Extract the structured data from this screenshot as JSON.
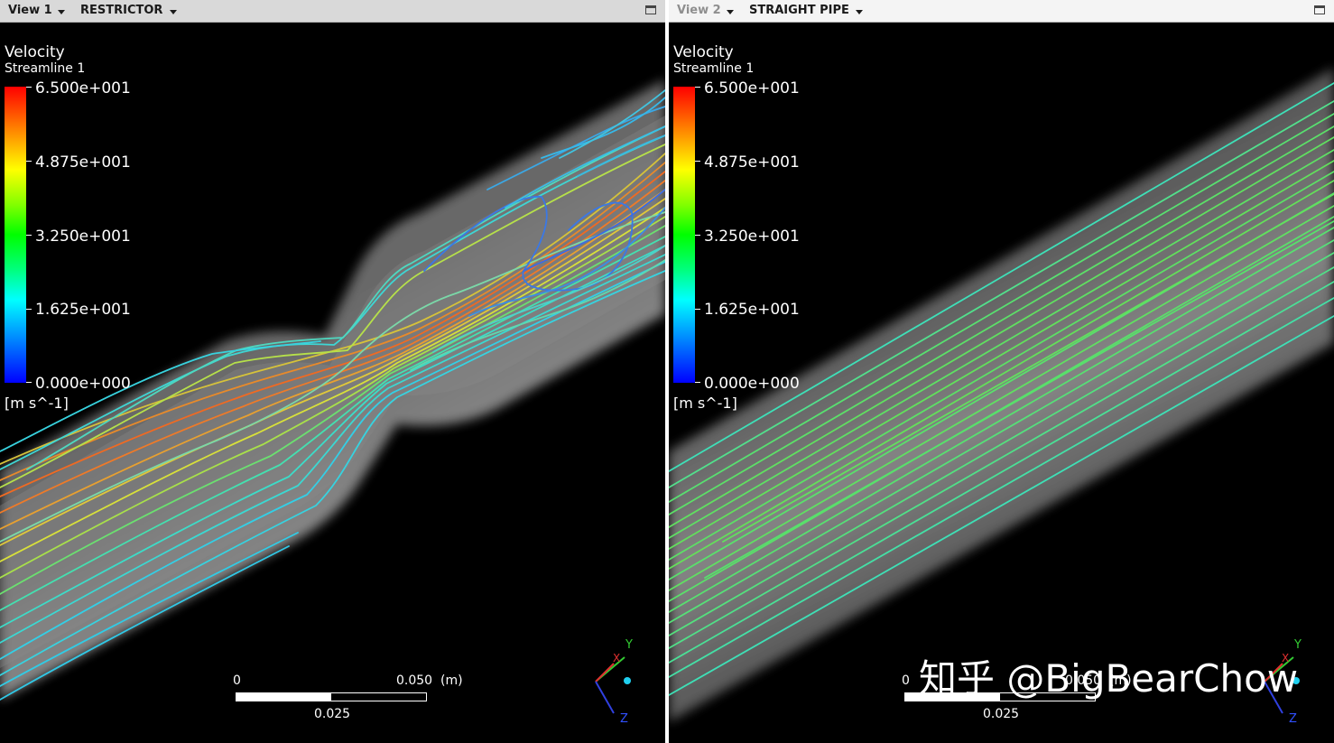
{
  "views": [
    {
      "id": "left",
      "view_label": "View 1",
      "view_label_dimmed": false,
      "object_label": "RESTRICTOR",
      "legend": {
        "variable": "Velocity",
        "object": "Streamline 1",
        "ticks": [
          "6.500e+001",
          "4.875e+001",
          "3.250e+001",
          "1.625e+001",
          "0.000e+000"
        ],
        "unit": "[m s^-1]"
      },
      "scale": {
        "zero": "0",
        "end": "0.050",
        "unit": "(m)",
        "mid": "0.025"
      },
      "axes": {
        "x": "X",
        "y": "Y",
        "z": "Z"
      }
    },
    {
      "id": "right",
      "view_label": "View 2",
      "view_label_dimmed": true,
      "object_label": "STRAIGHT PIPE",
      "legend": {
        "variable": "Velocity",
        "object": "Streamline 1",
        "ticks": [
          "6.500e+001",
          "4.875e+001",
          "3.250e+001",
          "1.625e+001",
          "0.000e+000"
        ],
        "unit": "[m s^-1]"
      },
      "scale": {
        "zero": "0",
        "end": "0.050",
        "unit": "(m)",
        "mid": "0.025"
      },
      "axes": {
        "x": "X",
        "y": "Y",
        "z": "Z"
      }
    }
  ],
  "watermark": "知乎 @BigBearChow",
  "colors": {
    "background": "#000000",
    "pipe": "#8c8c8c",
    "streamline_inlet": "#33d9e6",
    "streamline_straight": "#55e060",
    "streamline_throat": "#ff7a1a"
  }
}
